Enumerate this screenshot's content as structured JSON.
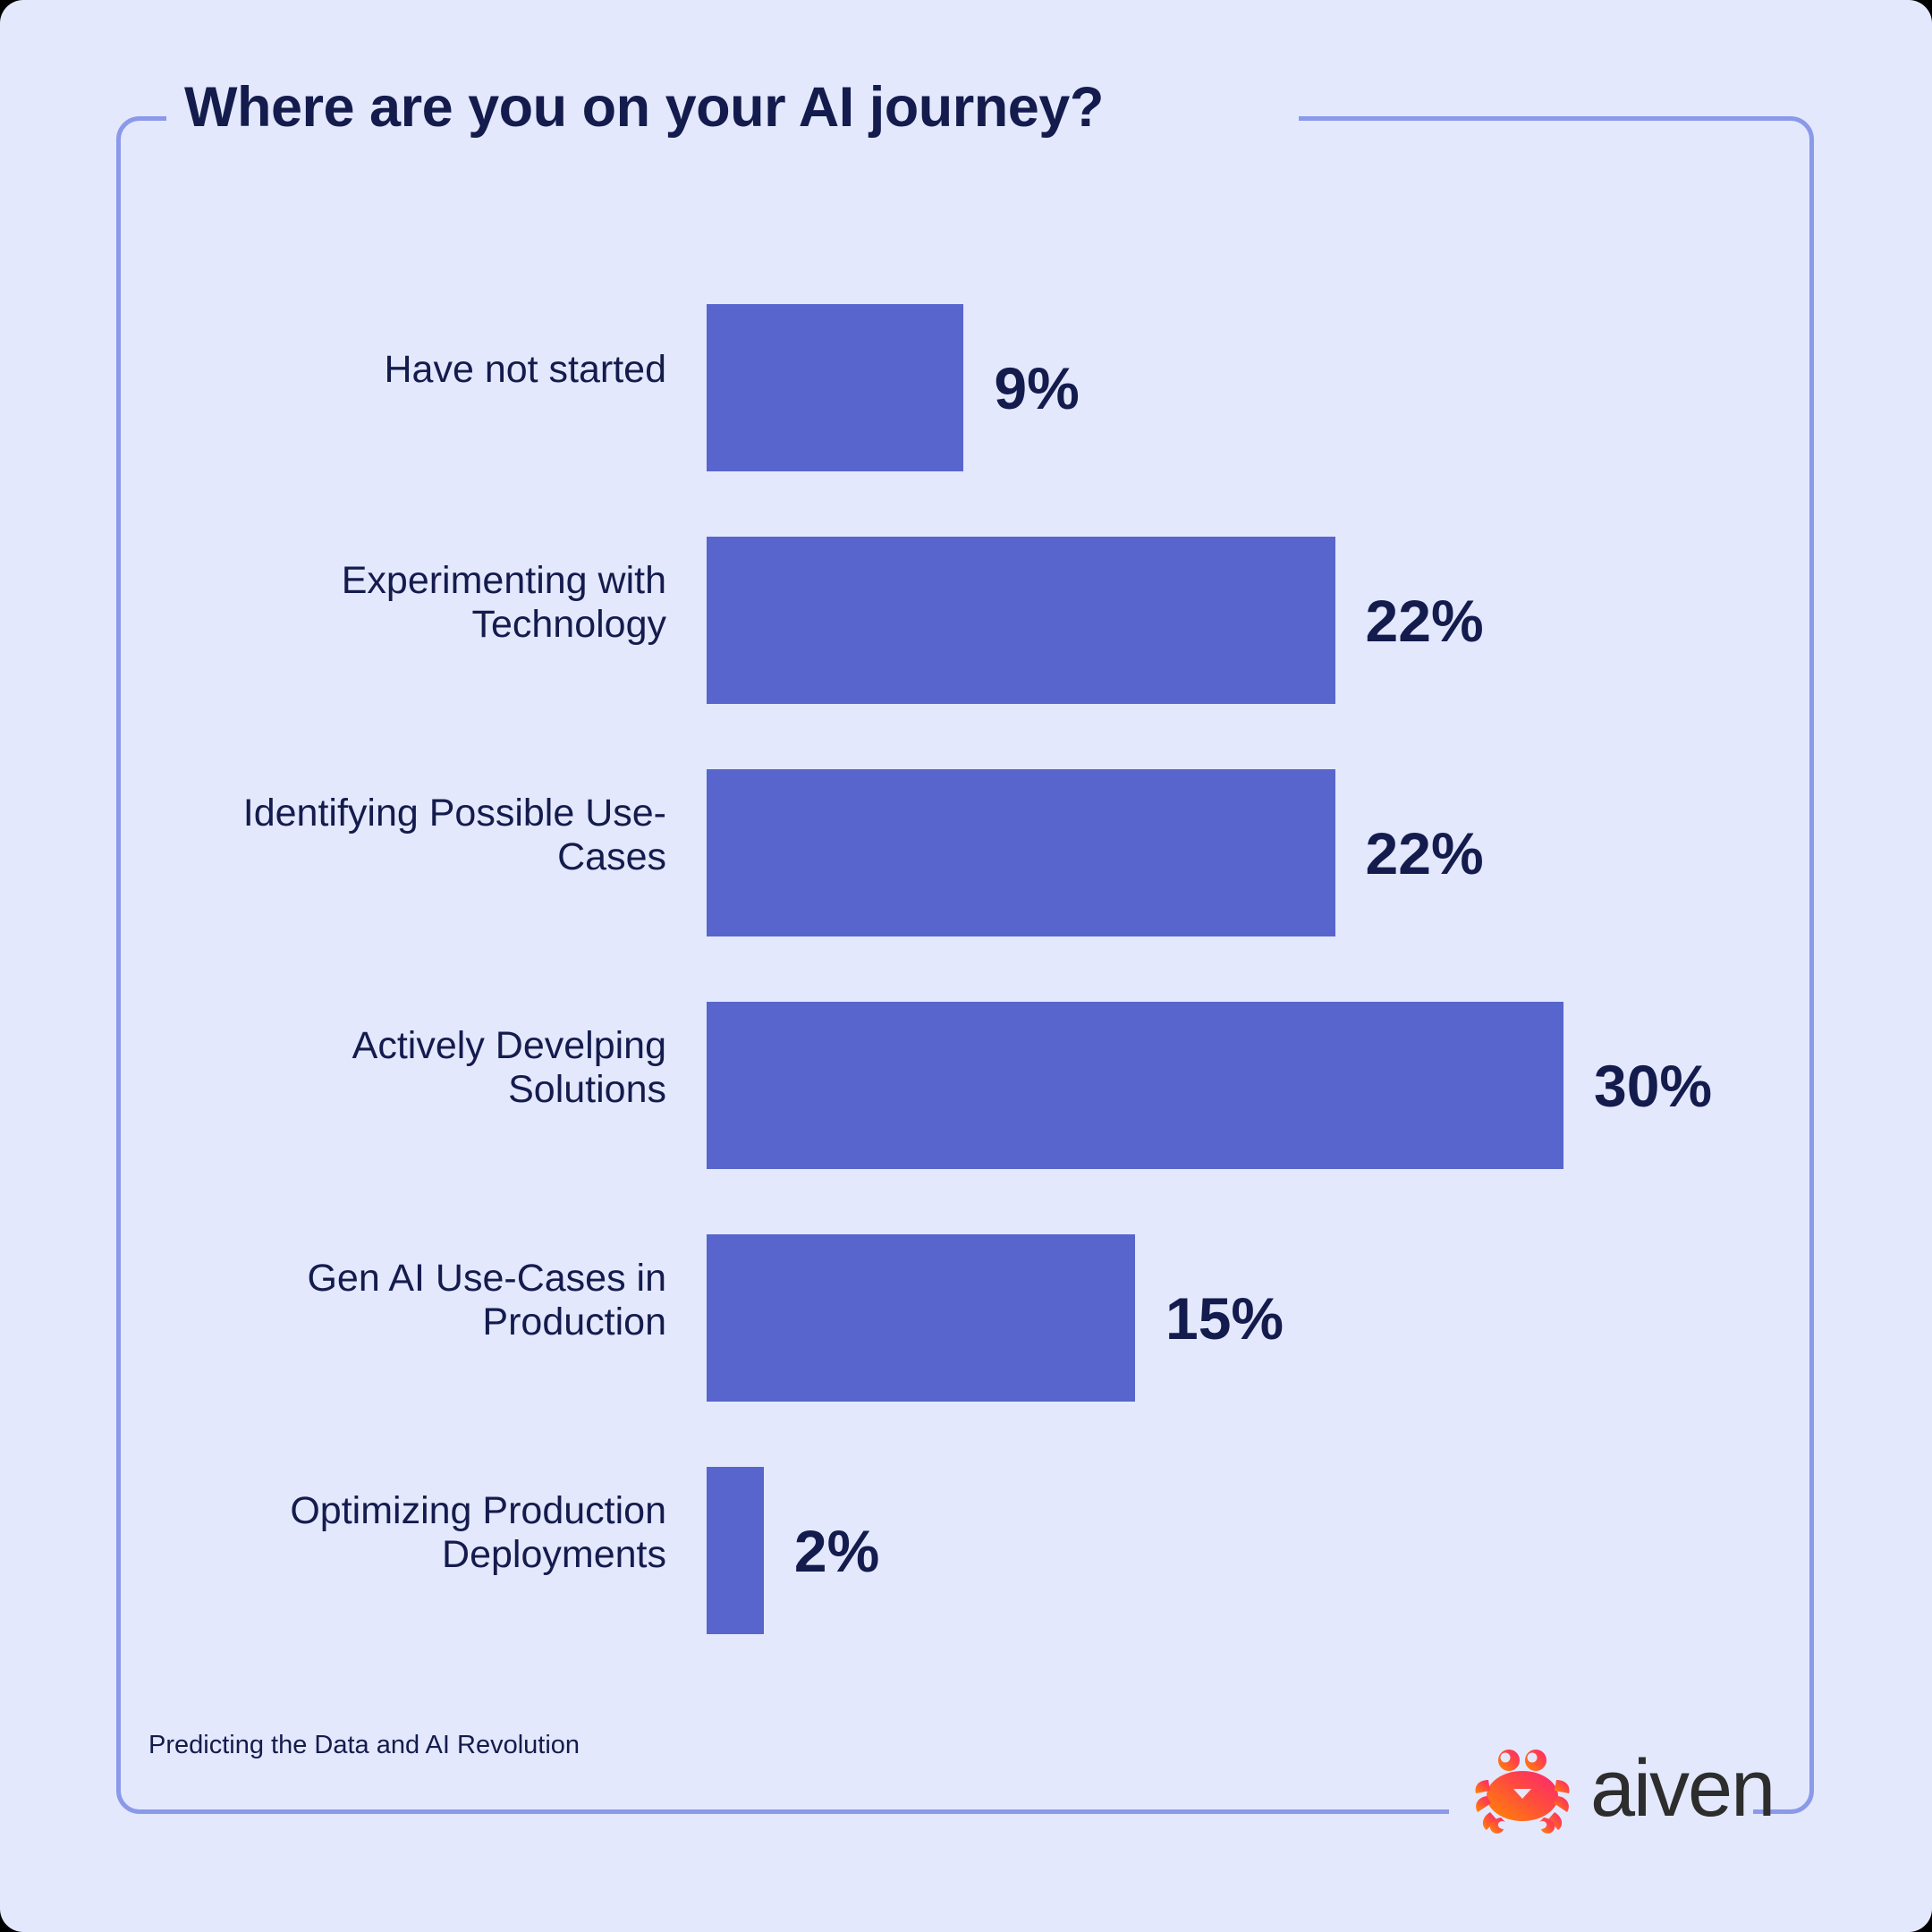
{
  "chart_data": {
    "type": "bar",
    "orientation": "horizontal",
    "title": "Where are you on your AI journey?",
    "xlabel": "",
    "ylabel": "",
    "xlim": [
      0,
      30
    ],
    "grid": false,
    "legend": null,
    "categories": [
      "Have not started",
      "Experimenting with Technology",
      "Identifying Possible Use-Cases",
      "Actively Develping Solutions",
      "Gen AI Use-Cases in Production",
      "Optimizing Production Deployments"
    ],
    "values": [
      9,
      22,
      22,
      30,
      15,
      2
    ],
    "value_labels": [
      "9%",
      "22%",
      "22%",
      "30%",
      "15%",
      "2%"
    ],
    "unit": "%",
    "bar_color": "#5865CC",
    "text_color": "#141B4D",
    "background_color": "#E3E8FC",
    "frame_color": "#8B99EA"
  },
  "footer": {
    "note": "Predicting the Data and AI Revolution",
    "brand": "aiven"
  }
}
